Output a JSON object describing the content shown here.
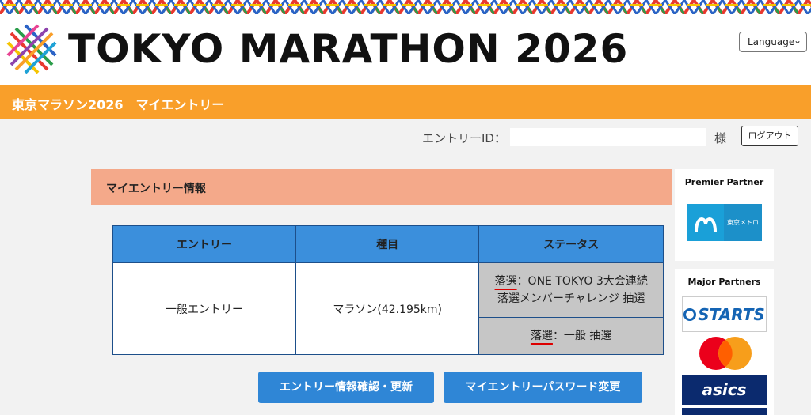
{
  "header": {
    "site_title": "TOKYO MARATHON 2026",
    "language_label": "Language",
    "subtitle": "東京マラソン2026　マイエントリー"
  },
  "account": {
    "entry_id_label": "エントリーID：",
    "entry_id_value": "",
    "honorific": "様",
    "logout_label": "ログアウト"
  },
  "section": {
    "title": "マイエントリー情報"
  },
  "table": {
    "headers": [
      "エントリー",
      "種目",
      "ステータス"
    ],
    "row": {
      "entry": "一般エントリー",
      "event": "マラソン(42.195km)",
      "status1_result": "落選",
      "status1_text": "：ONE TOKYO 3大会連続",
      "status1_line2": "落選メンバーチャレンジ 抽選",
      "status2_result": "落選",
      "status2_text": "：一般 抽選"
    }
  },
  "buttons": {
    "update": "エントリー情報確認・更新",
    "password": "マイエントリーパスワード変更"
  },
  "partners": {
    "premier_title": "Premier Partner",
    "premier_logo_text": "東京メトロ",
    "major_title": "Major Partners",
    "starts_logo_text": "STARTS",
    "asics_logo_text": "asics"
  },
  "colors": {
    "orange_bar": "#f99f2a",
    "section_head": "#f4a98a",
    "table_header": "#3b8fdc",
    "button": "#2f86d6",
    "status_bg": "#c6c6c6"
  }
}
